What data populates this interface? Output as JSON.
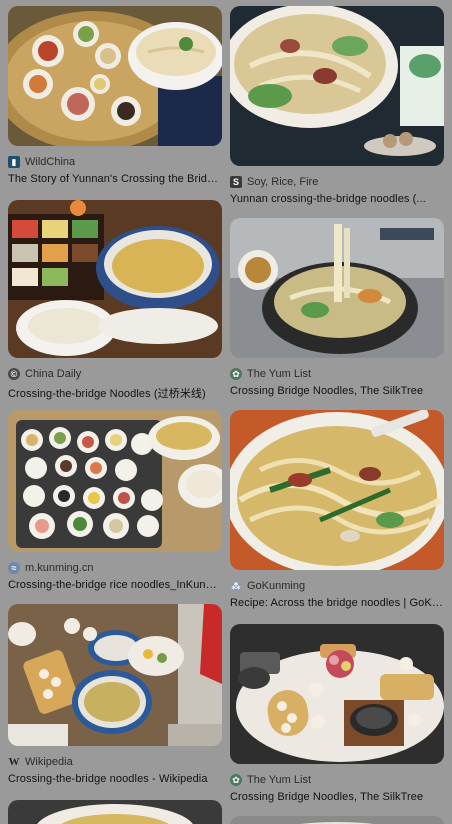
{
  "results": [
    {
      "source": "WildChina",
      "title": "The Story of Yunnan's Crossing the Bridge Noodles",
      "favicon": "wildchina-icon"
    },
    {
      "source": "Soy, Rice, Fire",
      "title": "Yunnan crossing-the-bridge noodles (...",
      "favicon": "soy-rice-fire-icon"
    },
    {
      "source": "China Daily",
      "title": "Crossing-the-bridge Noodles (过桥米线)",
      "favicon": "china-daily-icon"
    },
    {
      "source": "The Yum List",
      "title": "Crossing Bridge Noodles, The SilkTree",
      "favicon": "yum-list-icon"
    },
    {
      "source": "m.kunming.cn",
      "title": "Crossing-the-bridge rice noodles_InKunming",
      "favicon": "kunming-icon"
    },
    {
      "source": "GoKunming",
      "title": "Recipe: Across the bridge noodles | GoKunming",
      "favicon": "gokunming-icon"
    },
    {
      "source": "Wikipedia",
      "title": "Crossing-the-bridge noodles - Wikipedia",
      "favicon": "wikipedia-icon"
    },
    {
      "source": "The Yum List",
      "title": "Crossing Bridge Noodles, The SilkTree",
      "favicon": "yum-list-icon"
    }
  ],
  "colors": {
    "page_bg": "#9a9a9a",
    "text": "#121212"
  }
}
